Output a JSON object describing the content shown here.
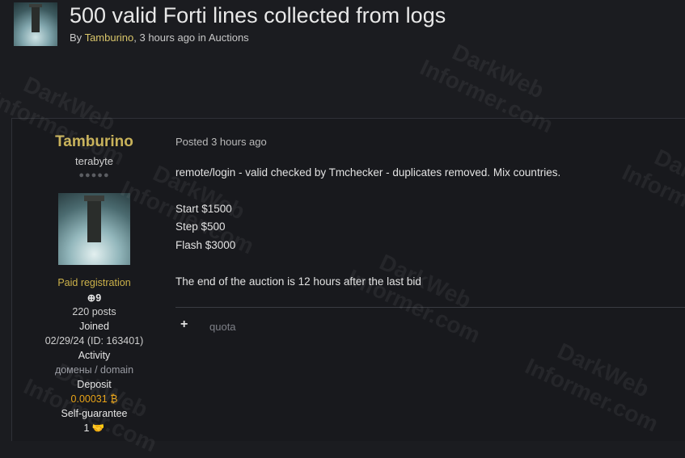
{
  "topic": {
    "title": "500 valid Forti lines collected from logs",
    "by_prefix": "By",
    "author": "Tamburino",
    "time": ", 3 hours ago",
    "in_prefix": "in",
    "forum": "Auctions"
  },
  "author_panel": {
    "name": "Tamburino",
    "rank": "terabyte",
    "rank_dots": "●●●●●",
    "group": "Paid registration",
    "reputation": "9",
    "posts": "220 posts",
    "joined_label": "Joined",
    "joined_value": "02/29/24 (ID: 163401)",
    "activity_label": "Activity",
    "activity_value": "домены / domain",
    "deposit_label": "Deposit",
    "deposit_value": "0.00031 ₿",
    "guarantee_label": "Self-guarantee",
    "guarantee_value": "1"
  },
  "post": {
    "posted": "Posted 3 hours ago",
    "line1": "remote/login - valid checked by Tmchecker - duplicates removed. Mix countries.",
    "line2": "Start $1500",
    "line3": "Step $500",
    "line4": "Flash $3000",
    "line5": "The end of the auction is 12 hours after the last bid",
    "quote_label": "quota",
    "plus_label": "+"
  },
  "watermark": {
    "line1": "DarkWeb",
    "line2": "Informer.com"
  }
}
